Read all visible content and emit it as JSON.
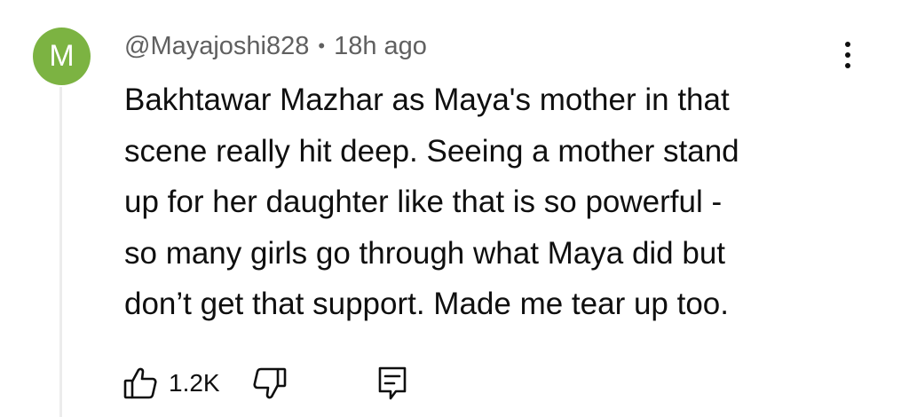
{
  "comment": {
    "avatar_letter": "M",
    "avatar_color": "#7cb342",
    "author": "@Mayajoshi828",
    "separator": "•",
    "time": "18h ago",
    "text": "Bakhtawar Mazhar as Maya's mother in that\nscene really hit deep. Seeing a mother stand\nup for her daughter like that is so powerful -\nso many girls go through what Maya did but\ndon’t get that support. Made me tear up too.",
    "like_count": "1.2K"
  },
  "icons": {
    "more": "more-vertical-icon",
    "like": "thumbs-up-icon",
    "dislike": "thumbs-down-icon",
    "reply": "reply-comment-icon"
  }
}
